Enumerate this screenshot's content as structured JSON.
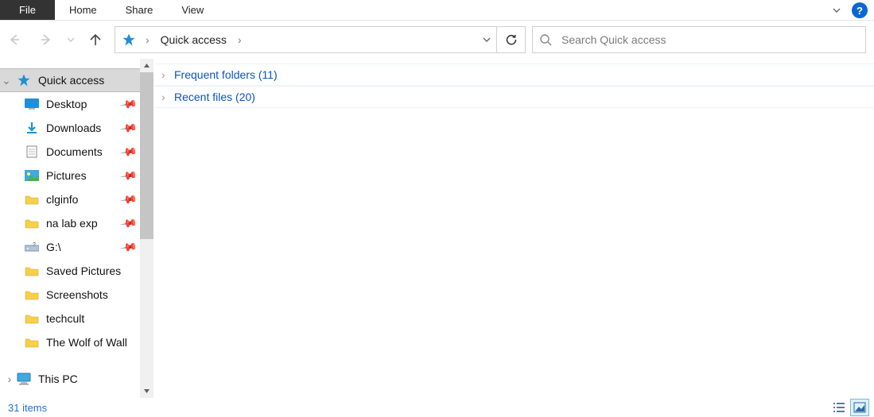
{
  "ribbon": {
    "file_tab": "File",
    "tabs": [
      "Home",
      "Share",
      "View"
    ]
  },
  "addressbar": {
    "location": "Quick access",
    "icon": "quick-access-star"
  },
  "search": {
    "placeholder": "Search Quick access"
  },
  "nav": {
    "selected": {
      "label": "Quick access",
      "icon": "star"
    },
    "pinned": [
      {
        "label": "Desktop",
        "icon": "desktop",
        "pinned": true
      },
      {
        "label": "Downloads",
        "icon": "download",
        "pinned": true
      },
      {
        "label": "Documents",
        "icon": "document",
        "pinned": true
      },
      {
        "label": "Pictures",
        "icon": "picture",
        "pinned": true
      },
      {
        "label": "clginfo",
        "icon": "folder",
        "pinned": true
      },
      {
        "label": "na lab exp",
        "icon": "folder",
        "pinned": true
      },
      {
        "label": "G:\\",
        "icon": "drive",
        "pinned": true
      },
      {
        "label": "Saved Pictures",
        "icon": "folder",
        "pinned": false
      },
      {
        "label": "Screenshots",
        "icon": "folder",
        "pinned": false
      },
      {
        "label": "techcult",
        "icon": "folder",
        "pinned": false
      },
      {
        "label": "The Wolf of Wall",
        "icon": "folder",
        "pinned": false
      }
    ],
    "thispc": {
      "label": "This PC",
      "icon": "thispc"
    }
  },
  "groups": [
    {
      "label": "Frequent folders (11)"
    },
    {
      "label": "Recent files (20)"
    }
  ],
  "status": {
    "count_text": "31 items"
  },
  "view_mode": "large"
}
